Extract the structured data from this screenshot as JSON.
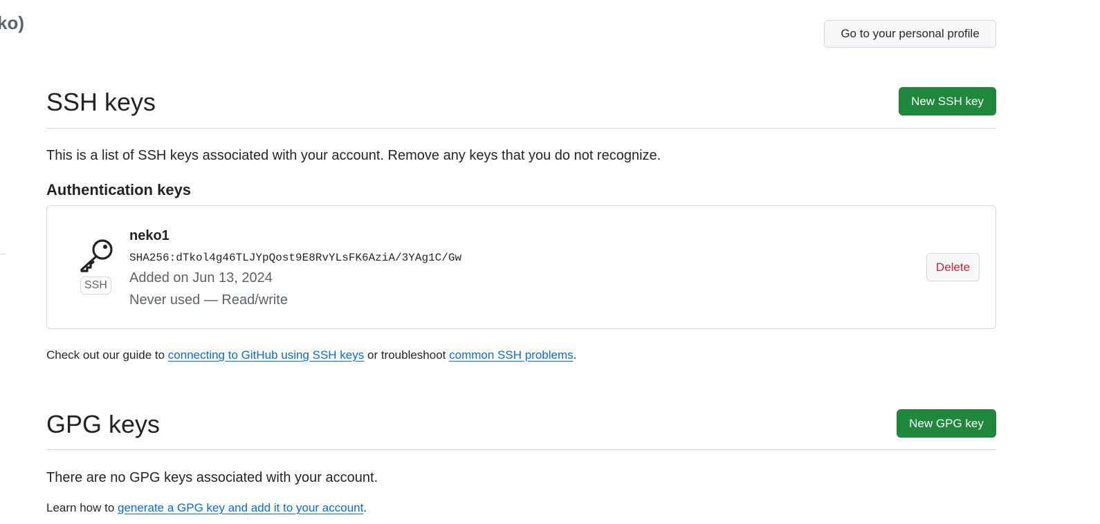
{
  "header": {
    "partial_title": "ko)",
    "profile_button": "Go to your personal profile"
  },
  "ssh": {
    "title": "SSH keys",
    "new_button": "New SSH key",
    "description": "This is a list of SSH keys associated with your account. Remove any keys that you do not recognize.",
    "auth_heading": "Authentication keys",
    "keys": [
      {
        "name": "neko1",
        "badge": "SSH",
        "fingerprint": "SHA256:dTkol4g46TLJYpQost9E8RvYLsFK6AziA/3YAg1C/Gw",
        "added": "Added on Jun 13, 2024",
        "usage": "Never used — Read/write",
        "delete_label": "Delete",
        "icon": "key-icon"
      }
    ],
    "guide": {
      "prefix": "Check out our guide to ",
      "link1": "connecting to GitHub using SSH keys",
      "middle": " or troubleshoot ",
      "link2": "common SSH problems",
      "suffix": "."
    }
  },
  "gpg": {
    "title": "GPG keys",
    "new_button": "New GPG key",
    "empty_text": "There are no GPG keys associated with your account.",
    "learn": {
      "prefix": "Learn how to ",
      "link": "generate a GPG key and add it to your account",
      "suffix": "."
    }
  },
  "colors": {
    "primary_button": "#1f883d",
    "link": "#0969da",
    "danger": "#cf222e",
    "muted_text": "#59636e",
    "border": "#d1d9e0"
  }
}
